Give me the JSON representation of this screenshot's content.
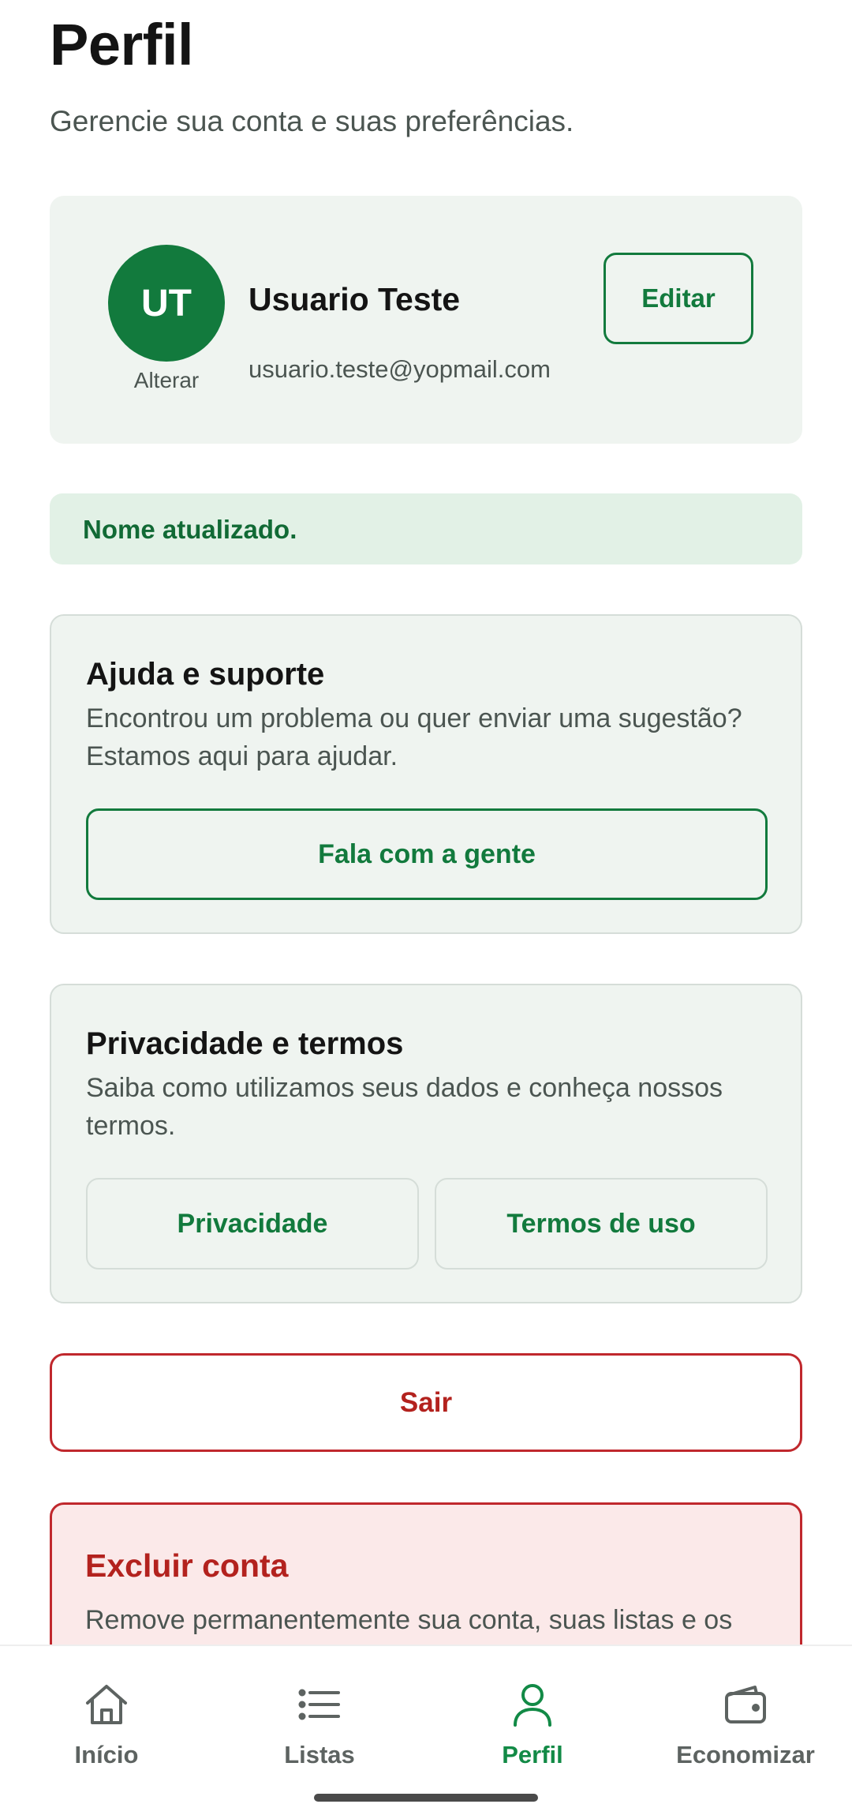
{
  "header": {
    "title": "Perfil",
    "subtitle": "Gerencie sua conta e suas preferências."
  },
  "profile": {
    "initials": "UT",
    "avatar_caption": "Alterar",
    "name": "Usuario Teste",
    "email": "usuario.teste@yopmail.com",
    "edit_label": "Editar"
  },
  "toast": {
    "message": "Nome atualizado."
  },
  "help": {
    "title": "Ajuda e suporte",
    "description": "Encontrou um problema ou quer enviar uma sugestão? Estamos aqui para ajudar.",
    "button_label": "Fala com a gente"
  },
  "privacy": {
    "title": "Privacidade e termos",
    "description": "Saiba como utilizamos seus dados e conheça nossos termos.",
    "privacy_label": "Privacidade",
    "terms_label": "Termos de uso"
  },
  "logout": {
    "label": "Sair"
  },
  "delete_account": {
    "title": "Excluir conta",
    "description": "Remove permanentemente sua conta, suas listas e os"
  },
  "bottom_nav": {
    "items": [
      {
        "label": "Início",
        "icon": "home-icon"
      },
      {
        "label": "Listas",
        "icon": "list-icon"
      },
      {
        "label": "Perfil",
        "icon": "person-icon",
        "active": true
      },
      {
        "label": "Economizar",
        "icon": "wallet-icon"
      }
    ]
  },
  "colors": {
    "brand_green": "#127a3d",
    "active_nav_green": "#128a46",
    "danger_red": "#b3221e",
    "card_background": "#eff4f0",
    "toast_background": "#e2f1e6",
    "danger_background": "#fbe9e9"
  }
}
